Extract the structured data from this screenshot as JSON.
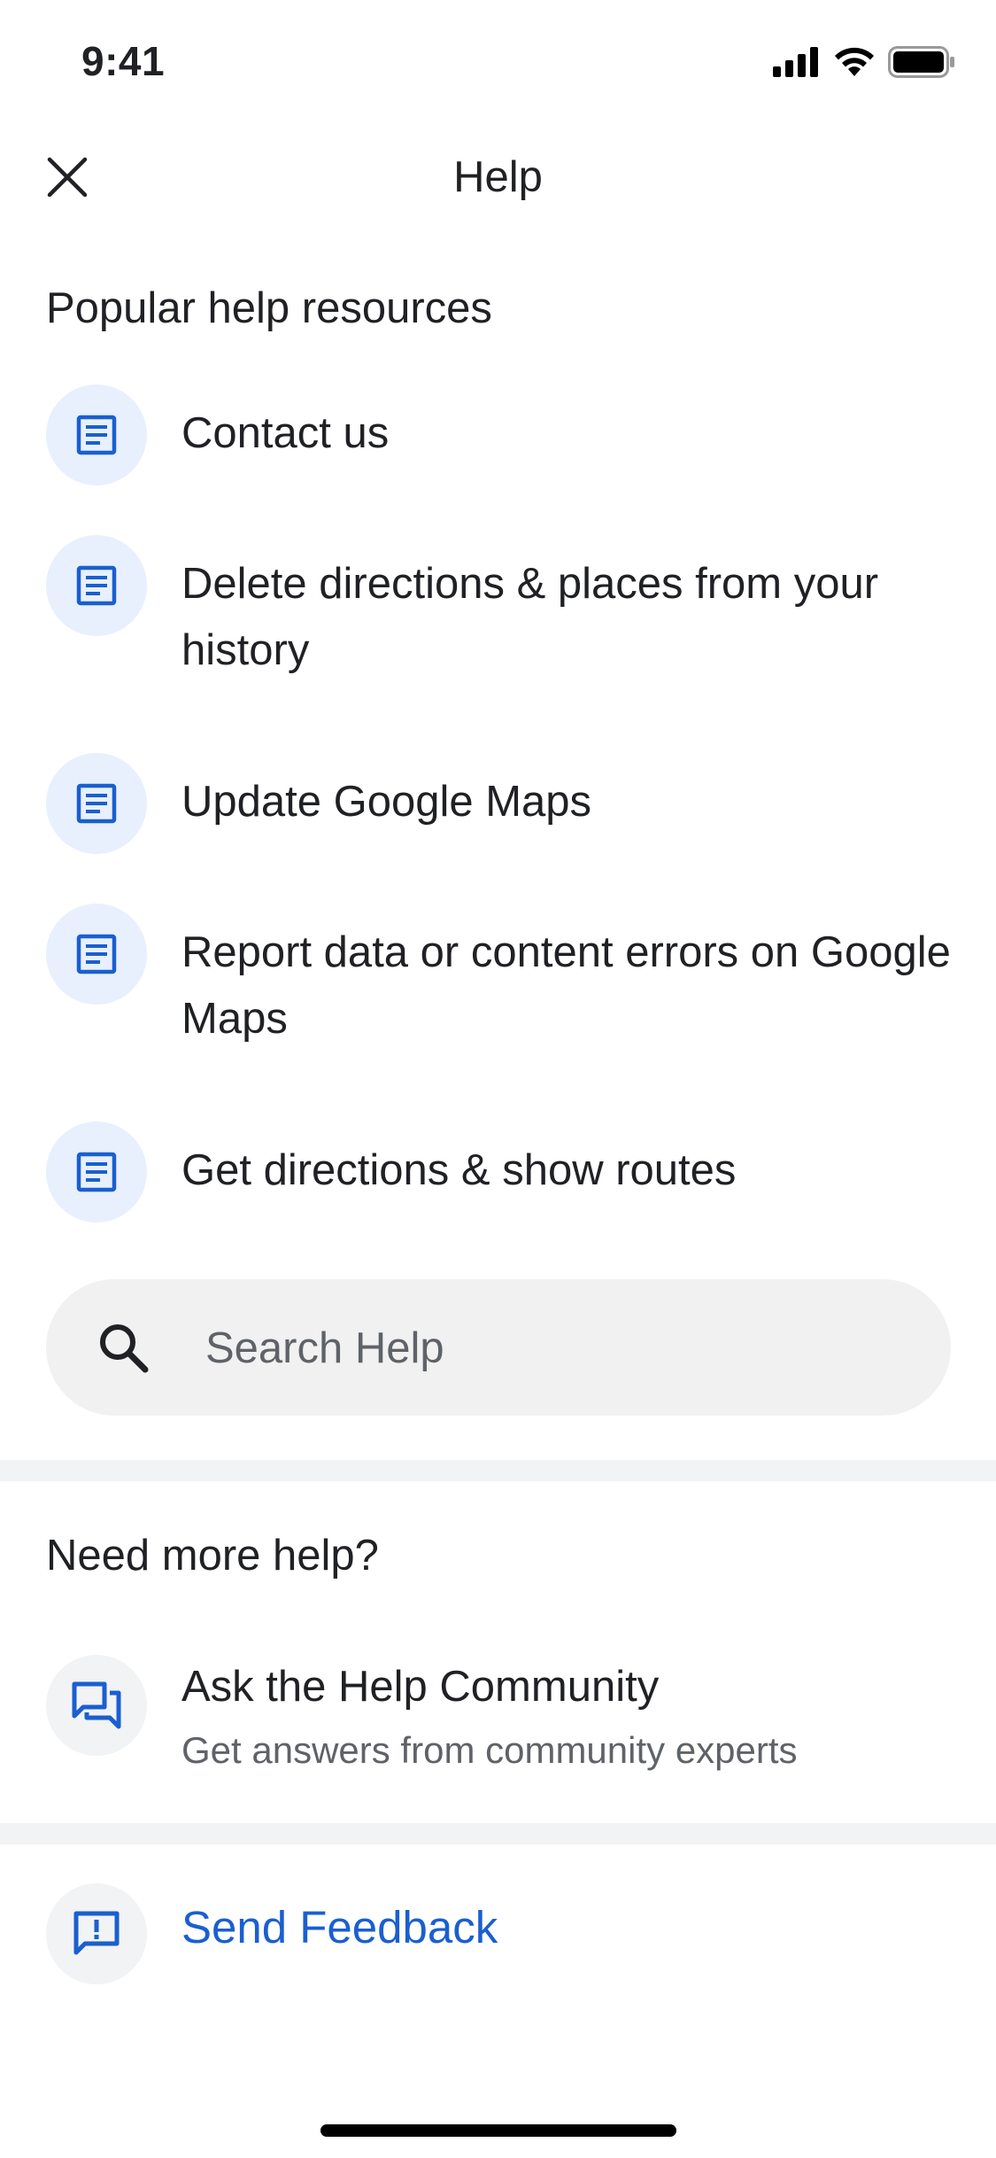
{
  "status_bar": {
    "time": "9:41",
    "icons": [
      "signal-icon",
      "wifi-icon",
      "battery-icon"
    ]
  },
  "header": {
    "title": "Help",
    "close_icon": "close-icon"
  },
  "popular": {
    "title": "Popular help resources",
    "items": [
      {
        "label": "Contact us",
        "icon": "article-icon"
      },
      {
        "label": "Delete directions & places from your history",
        "icon": "article-icon"
      },
      {
        "label": "Update Google Maps",
        "icon": "article-icon"
      },
      {
        "label": "Report data or content errors on Google Maps",
        "icon": "article-icon"
      },
      {
        "label": "Get directions & show routes",
        "icon": "article-icon"
      }
    ]
  },
  "search": {
    "placeholder": "Search Help",
    "icon": "search-icon"
  },
  "more_help": {
    "title": "Need more help?",
    "community": {
      "title": "Ask the Help Community",
      "subtitle": "Get answers from community experts",
      "icon": "forum-icon"
    }
  },
  "feedback": {
    "label": "Send Feedback",
    "icon": "feedback-icon"
  },
  "colors": {
    "accent": "#1a5fd0",
    "icon_bg_blue": "#e8f0fe",
    "icon_bg_gray": "#f1f3f4",
    "divider": "#f1f3f4",
    "search_bg": "#f1f1f1"
  }
}
